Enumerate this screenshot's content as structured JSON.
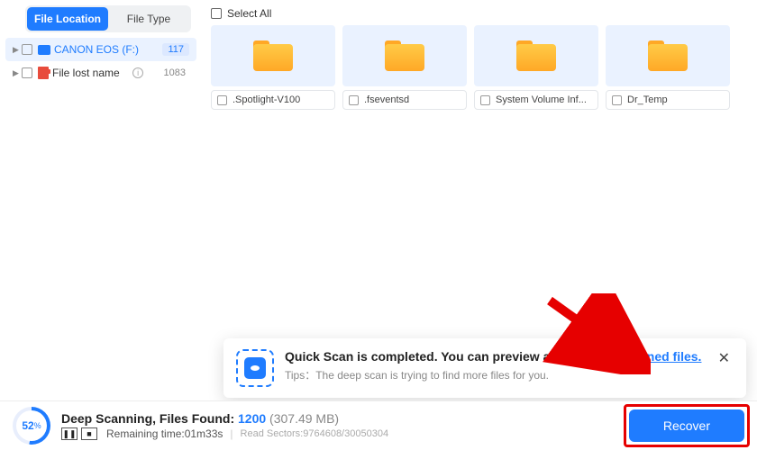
{
  "sidebar": {
    "tabs": {
      "location": "File Location",
      "type": "File Type"
    },
    "items": [
      {
        "label": "CANON EOS (F:)",
        "count": "117"
      },
      {
        "label": "File lost name",
        "count": "1083"
      }
    ]
  },
  "main": {
    "select_all": "Select All",
    "folders": [
      {
        "name": ".Spotlight-V100"
      },
      {
        "name": ".fseventsd"
      },
      {
        "name": "System Volume Inf..."
      },
      {
        "name": "Dr_Temp"
      }
    ]
  },
  "notice": {
    "title_a": "Quick Scan is completed. You can preview and ",
    "title_link": "recover scanned files.",
    "sub": "Tips：The deep scan is trying to find more files for you."
  },
  "footer": {
    "pct": "52",
    "pct_unit": "%",
    "title_a": "Deep Scanning, Files Found: ",
    "found": "1200",
    "size": " (307.49 MB)",
    "remain_lbl": "Remaining time: ",
    "remain_val": "01m33s",
    "sectors_lbl": "Read Sectors: ",
    "sectors_val": "9764608/30050304",
    "recover": "Recover"
  }
}
